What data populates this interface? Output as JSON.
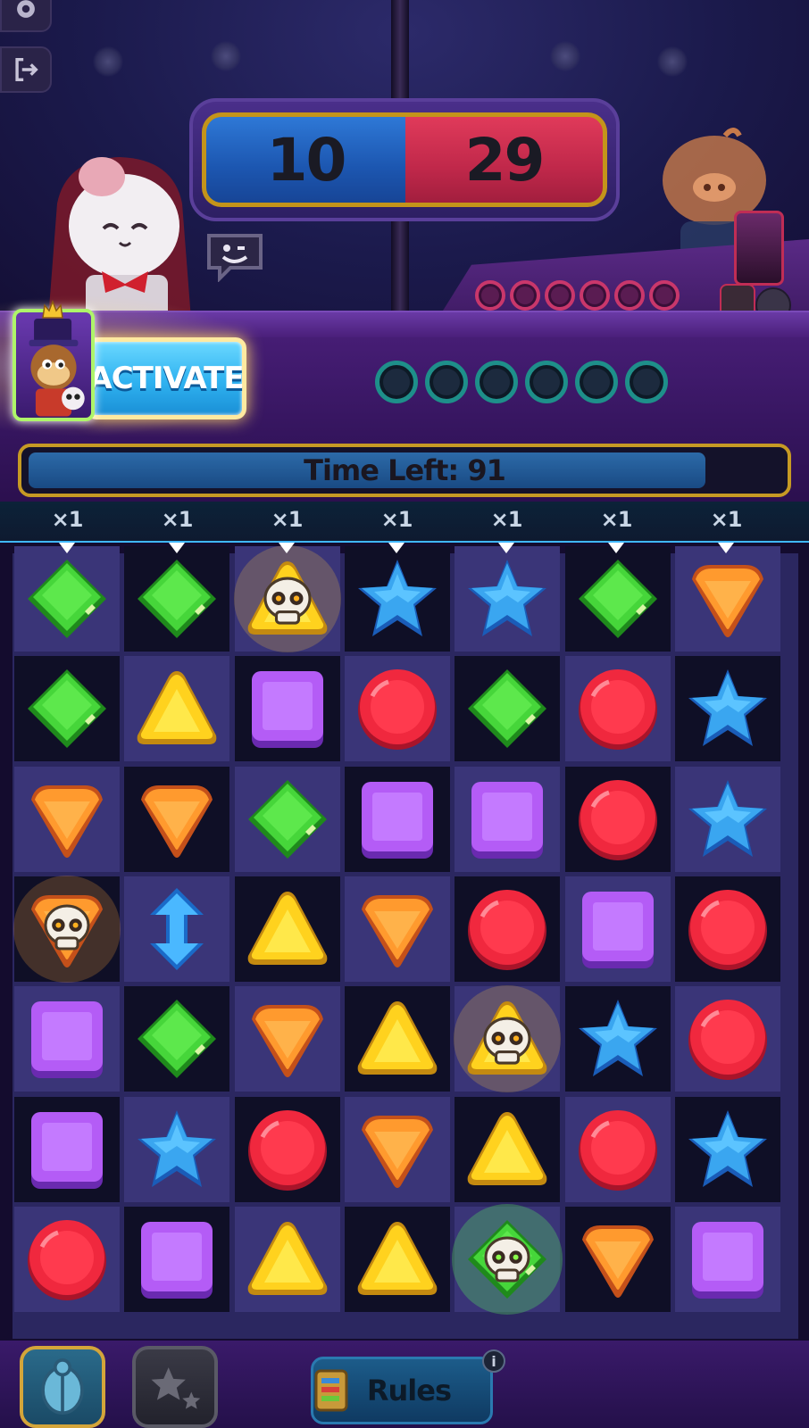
{
  "top_bar": {
    "settings_icon": "gear-icon",
    "exit_icon": "exit-icon"
  },
  "scoreboard": {
    "player_score": "10",
    "opponent_score": "29",
    "player_color": "#2e78d6",
    "opponent_color": "#e03a5a"
  },
  "opponent": {
    "charge_slots": 6,
    "charged": 0
  },
  "player": {
    "activate_label": "ACTIVATE",
    "charge_slots": 6,
    "charged": 0
  },
  "timer": {
    "label": "Time Left: 91",
    "fill_fraction": 0.9
  },
  "multipliers": [
    "×1",
    "×1",
    "×1",
    "×1",
    "×1",
    "×1",
    "×1"
  ],
  "board": {
    "rows": 7,
    "cols": 7,
    "grid": [
      [
        "green",
        "green",
        "yellow-skull",
        "blue",
        "blue",
        "green",
        "orange"
      ],
      [
        "green",
        "yellow",
        "purple",
        "red",
        "green",
        "red",
        "blue"
      ],
      [
        "orange",
        "orange",
        "green",
        "purple",
        "purple",
        "red",
        "blue"
      ],
      [
        "orange-skull",
        "arrow",
        "yellow",
        "orange",
        "red",
        "purple",
        "red"
      ],
      [
        "purple",
        "green",
        "orange",
        "yellow",
        "yellow-skull",
        "blue",
        "red"
      ],
      [
        "purple",
        "blue",
        "red",
        "orange",
        "yellow",
        "red",
        "blue"
      ],
      [
        "red",
        "purple",
        "yellow",
        "yellow",
        "green-skull",
        "orange",
        "purple"
      ]
    ]
  },
  "bottom_bar": {
    "rules_label": "Rules",
    "info_badge": "i"
  }
}
